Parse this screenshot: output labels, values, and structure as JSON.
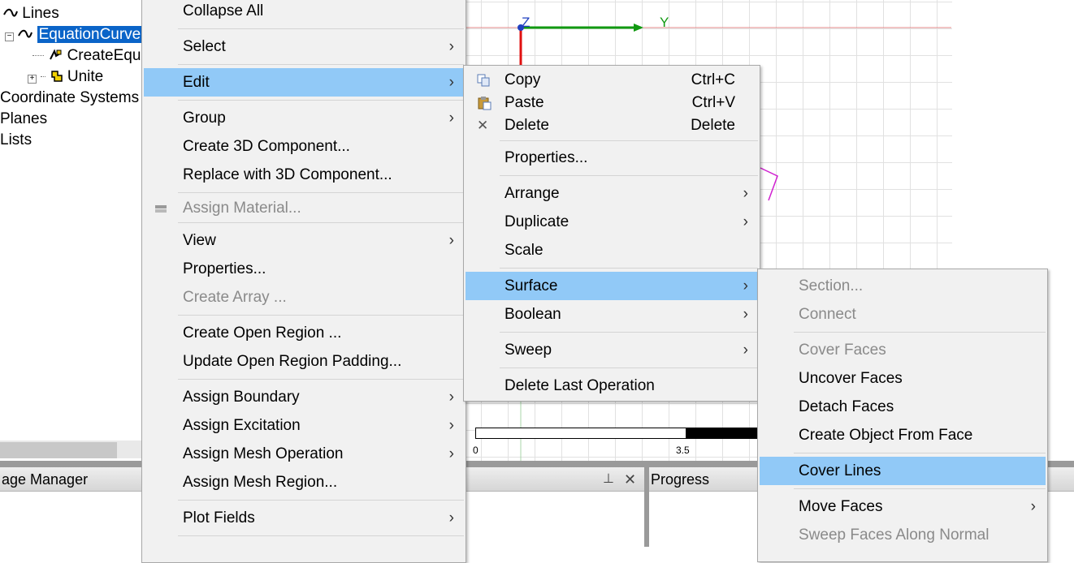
{
  "tree": {
    "items": [
      {
        "label": "Lines",
        "icon": "line-icon"
      },
      {
        "label": "EquationCurve",
        "icon": "curve-icon",
        "selected": true
      },
      {
        "label": "CreateEqua",
        "icon": "create-equation-icon"
      },
      {
        "label": "Unite",
        "icon": "unite-icon"
      },
      {
        "label": "Coordinate Systems"
      },
      {
        "label": "Planes"
      },
      {
        "label": "Lists"
      }
    ]
  },
  "viewport": {
    "axis_z": "Z",
    "axis_y": "Y",
    "scale_start": "0",
    "scale_mid": "3.5",
    "colors": {
      "x_axis": "#e01010",
      "y_axis": "#119911",
      "z_marker": "#2040c0",
      "curve": "#d020d0"
    }
  },
  "bottom": {
    "message_manager_title": "age Manager",
    "progress_title": "Progress",
    "pin_icon": "pin-icon",
    "close_icon": "close-icon"
  },
  "menu_main": {
    "items": [
      {
        "label": "Collapse All"
      },
      {
        "label": "Select",
        "submenu": true
      },
      {
        "label": "Edit",
        "submenu": true,
        "highlighted": true
      },
      {
        "label": "Group",
        "submenu": true
      },
      {
        "label": "Create 3D Component..."
      },
      {
        "label": "Replace with 3D Component..."
      },
      {
        "label": "Assign Material...",
        "disabled": true,
        "icon": "material-icon"
      },
      {
        "label": "View",
        "submenu": true
      },
      {
        "label": "Properties..."
      },
      {
        "label": "Create Array ...",
        "disabled": true
      },
      {
        "label": "Create Open Region ..."
      },
      {
        "label": "Update Open Region Padding..."
      },
      {
        "label": "Assign Boundary",
        "submenu": true
      },
      {
        "label": "Assign Excitation",
        "submenu": true
      },
      {
        "label": "Assign Mesh Operation",
        "submenu": true
      },
      {
        "label": "Assign Mesh Region..."
      },
      {
        "label": "Plot Fields",
        "submenu": true
      }
    ]
  },
  "menu_edit": {
    "items": [
      {
        "label": "Copy",
        "shortcut": "Ctrl+C",
        "icon": "copy-icon"
      },
      {
        "label": "Paste",
        "shortcut": "Ctrl+V",
        "icon": "paste-icon"
      },
      {
        "label": "Delete",
        "shortcut": "Delete",
        "icon": "delete-icon"
      },
      {
        "label": "Properties..."
      },
      {
        "label": "Arrange",
        "submenu": true
      },
      {
        "label": "Duplicate",
        "submenu": true
      },
      {
        "label": "Scale"
      },
      {
        "label": "Surface",
        "submenu": true,
        "highlighted": true
      },
      {
        "label": "Boolean",
        "submenu": true
      },
      {
        "label": "Sweep",
        "submenu": true
      },
      {
        "label": "Delete Last Operation"
      }
    ]
  },
  "menu_surface": {
    "items": [
      {
        "label": "Section...",
        "disabled": true
      },
      {
        "label": "Connect",
        "disabled": true
      },
      {
        "label": "Cover Faces",
        "disabled": true
      },
      {
        "label": "Uncover Faces"
      },
      {
        "label": "Detach Faces"
      },
      {
        "label": "Create Object From Face"
      },
      {
        "label": "Cover Lines",
        "highlighted": true
      },
      {
        "label": "Move Faces",
        "submenu": true
      },
      {
        "label": "Sweep Faces Along Normal",
        "disabled": true
      }
    ]
  },
  "glyphs": {
    "arrow": "›",
    "delete_x": "✕"
  }
}
